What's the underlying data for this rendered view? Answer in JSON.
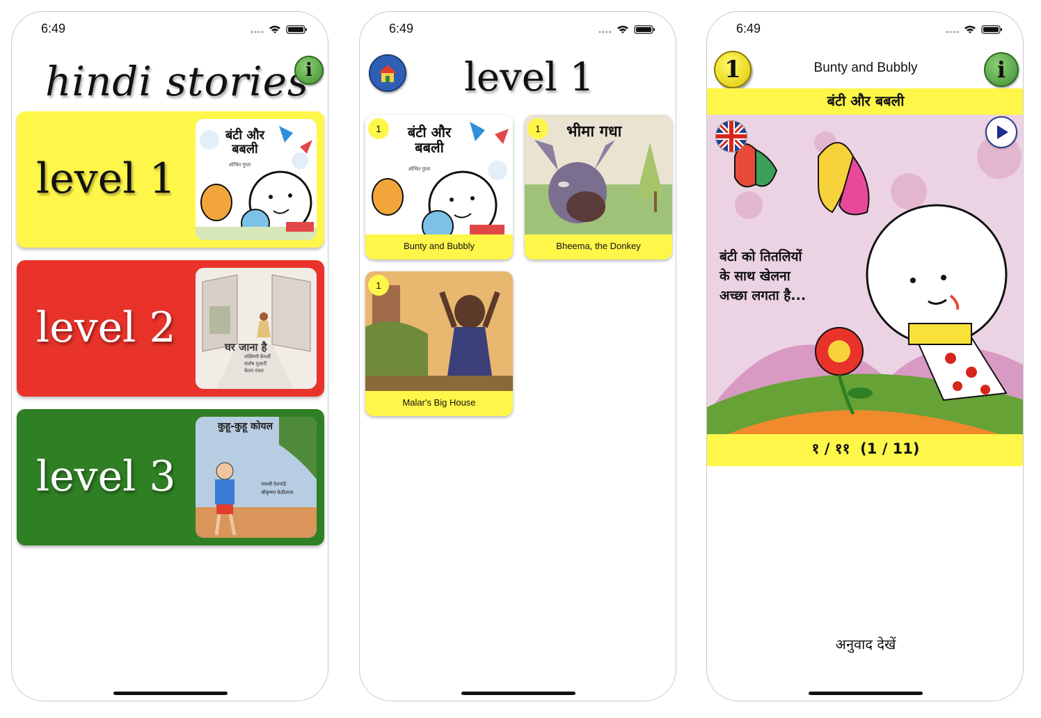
{
  "status_time": "6:49",
  "screen1": {
    "logo_text": "hindi stories",
    "info_label": "i",
    "levels": [
      {
        "label": "level 1",
        "bg": "#fff64a",
        "text_color": "#111111",
        "thumb_title": "बंटी और बबली",
        "thumb_author": "शोभित गुप्ता"
      },
      {
        "label": "level 2",
        "bg": "#e8322a",
        "text_color": "#ffffff",
        "thumb_title": "घर जाना है",
        "thumb_authors": [
          "रुक्मिणी बैनर्जी",
          "संतोष पुजारी",
          "केतन रावत"
        ]
      },
      {
        "label": "level 3",
        "bg": "#2f7f24",
        "text_color": "#ffffff",
        "thumb_title": "कुहू-कुहू कोयल",
        "thumb_authors": [
          "जयश्री देशपांडे",
          "श्रीकृष्णा केडीलाया"
        ]
      }
    ]
  },
  "screen2": {
    "title": "level 1",
    "books": [
      {
        "level": "1",
        "title": "Bunty and Bubbly",
        "cover_title": "बंटी और बबली",
        "cover_author": "शोभित गुप्ता"
      },
      {
        "level": "1",
        "title": "Bheema, the Donkey",
        "cover_title": "भीमा गधा"
      },
      {
        "level": "1",
        "title": "Malar's Big House"
      }
    ]
  },
  "screen3": {
    "level_badge": "1",
    "title": "Bunty and Bubbly",
    "info_label": "i",
    "hindi_title": "बंटी और बबली",
    "story_text": [
      "बंटी को तितलियों",
      "के साथ खेलना",
      "अच्छा लगता है..."
    ],
    "page_indicator": "१ / ११  (1 / 11)",
    "translate_label": "अनुवाद देखें"
  },
  "colors": {
    "yellow": "#fff64a",
    "red": "#e8322a",
    "green": "#2f7f24"
  }
}
